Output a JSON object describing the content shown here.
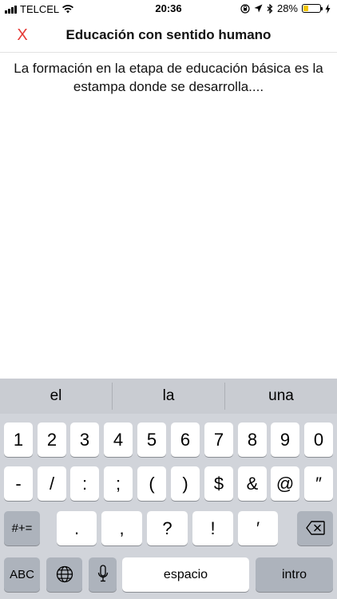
{
  "status_bar": {
    "carrier": "TELCEL",
    "time": "20:36",
    "battery_percent": "28%",
    "battery_level": 0.28,
    "battery_color": "#f2c500"
  },
  "nav": {
    "close_label": "X",
    "title": "Educación con sentido humano"
  },
  "content": {
    "text": "La formación en la etapa de educación básica es la estampa donde se desarrolla...."
  },
  "keyboard": {
    "suggestions": [
      "el",
      "la",
      "una"
    ],
    "row1": [
      "1",
      "2",
      "3",
      "4",
      "5",
      "6",
      "7",
      "8",
      "9",
      "0"
    ],
    "row2": [
      "-",
      "/",
      ":",
      ";",
      "(",
      ")",
      "$",
      "&",
      "@",
      "″"
    ],
    "row3": [
      "#+=",
      ".",
      ",",
      "?",
      "!",
      "′"
    ],
    "row4": [
      "ABC",
      "espacio",
      "intro"
    ],
    "icons": [
      "globe-icon",
      "mic-icon",
      "backspace-icon"
    ]
  },
  "colors": {
    "accent": "#e53935",
    "keyboard_bg": "#d1d4da",
    "key_dark": "#adb3bc"
  }
}
